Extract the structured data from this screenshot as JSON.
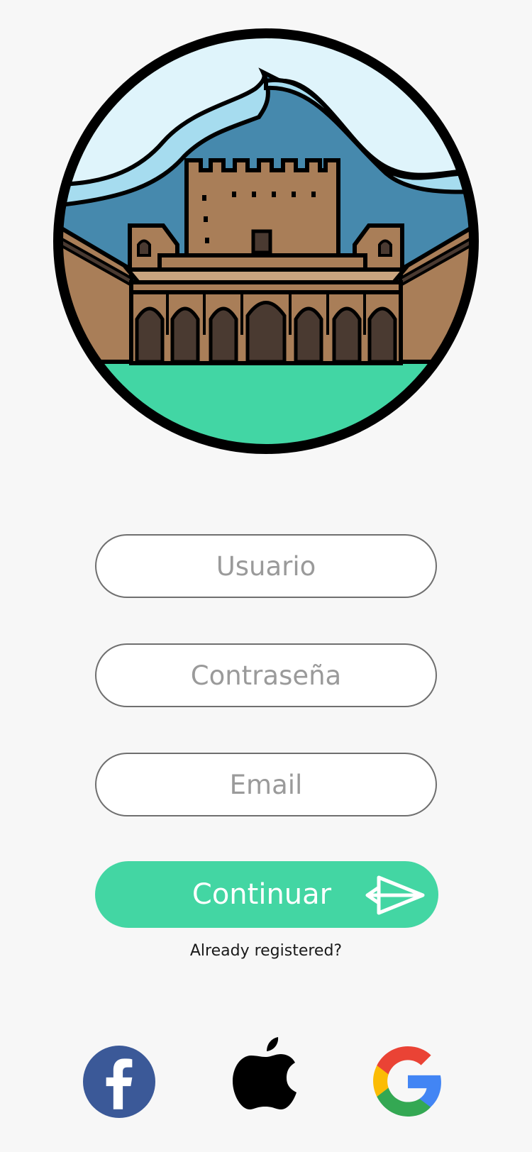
{
  "logo": {
    "description_icon": "alhambra-castle-logo"
  },
  "form": {
    "username_placeholder": "Usuario",
    "password_placeholder": "Contraseña",
    "email_placeholder": "Email"
  },
  "continue_button": {
    "label": "Continuar",
    "icon": "paper-plane-icon",
    "color": "#43d6a3"
  },
  "already_registered": "Already registered?",
  "social": {
    "facebook": {
      "icon": "facebook-icon",
      "color": "#3b5998"
    },
    "apple": {
      "icon": "apple-icon",
      "color": "#000000"
    },
    "google": {
      "icon": "google-icon"
    }
  },
  "colors": {
    "background": "#f7f7f7",
    "accent": "#43d6a3"
  }
}
